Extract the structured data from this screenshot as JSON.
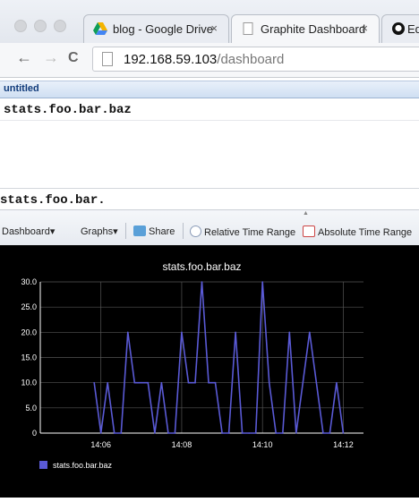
{
  "browser": {
    "tabs": [
      {
        "label": "blog - Google Drive",
        "close": "×",
        "icon": "google-drive-icon"
      },
      {
        "label": "Graphite Dashboard",
        "close": "×",
        "icon": "page-icon"
      },
      {
        "label": "Ed",
        "icon": "github-icon"
      }
    ],
    "nav": {
      "back": "←",
      "forward": "→",
      "reload": "C"
    },
    "url": {
      "host": "192.168.59.103",
      "path": "/dashboard"
    }
  },
  "dashboard": {
    "title": "untitled",
    "target_top": "stats.foo.bar.baz",
    "target_input": "stats.foo.bar.",
    "toolbar": {
      "dashboard": "Dashboard",
      "graphs": "Graphs",
      "share": "Share",
      "relative": "Relative Time Range",
      "absolute": "Absolute Time Range"
    }
  },
  "chart_data": {
    "type": "line",
    "title": "stats.foo.bar.baz",
    "xlabel": "",
    "ylabel": "",
    "ylim": [
      0,
      30
    ],
    "yticks": [
      "0",
      "5.0",
      "10.0",
      "15.0",
      "20.0",
      "25.0",
      "30.0"
    ],
    "xticks": [
      "14:06",
      "14:08",
      "14:10",
      "14:12"
    ],
    "xlim": [
      "14:04:30",
      "14:12:30"
    ],
    "grid": true,
    "legend": "bottom-left",
    "colors": {
      "background": "#000000",
      "series": "#5a5ad6",
      "axis": "#ffffff",
      "grid": "#555555"
    },
    "series": [
      {
        "name": "stats.foo.bar.baz",
        "x": [
          "14:05:50",
          "14:06:00",
          "14:06:10",
          "14:06:20",
          "14:06:30",
          "14:06:40",
          "14:06:50",
          "14:07:00",
          "14:07:10",
          "14:07:20",
          "14:07:30",
          "14:07:40",
          "14:07:50",
          "14:08:00",
          "14:08:10",
          "14:08:20",
          "14:08:30",
          "14:08:40",
          "14:08:50",
          "14:09:00",
          "14:09:10",
          "14:09:20",
          "14:09:30",
          "14:09:40",
          "14:09:50",
          "14:10:00",
          "14:10:10",
          "14:10:20",
          "14:10:30",
          "14:10:40",
          "14:10:50",
          "14:11:00",
          "14:11:10",
          "14:11:20",
          "14:11:30",
          "14:11:40",
          "14:11:50",
          "14:12:00"
        ],
        "values": [
          10,
          0,
          10,
          0,
          0,
          20,
          10,
          10,
          10,
          0,
          10,
          0,
          0,
          20,
          10,
          10,
          30,
          10,
          10,
          0,
          0,
          20,
          0,
          0,
          0,
          30,
          10,
          0,
          0,
          20,
          0,
          10,
          20,
          10,
          0,
          0,
          10,
          0
        ]
      }
    ]
  }
}
